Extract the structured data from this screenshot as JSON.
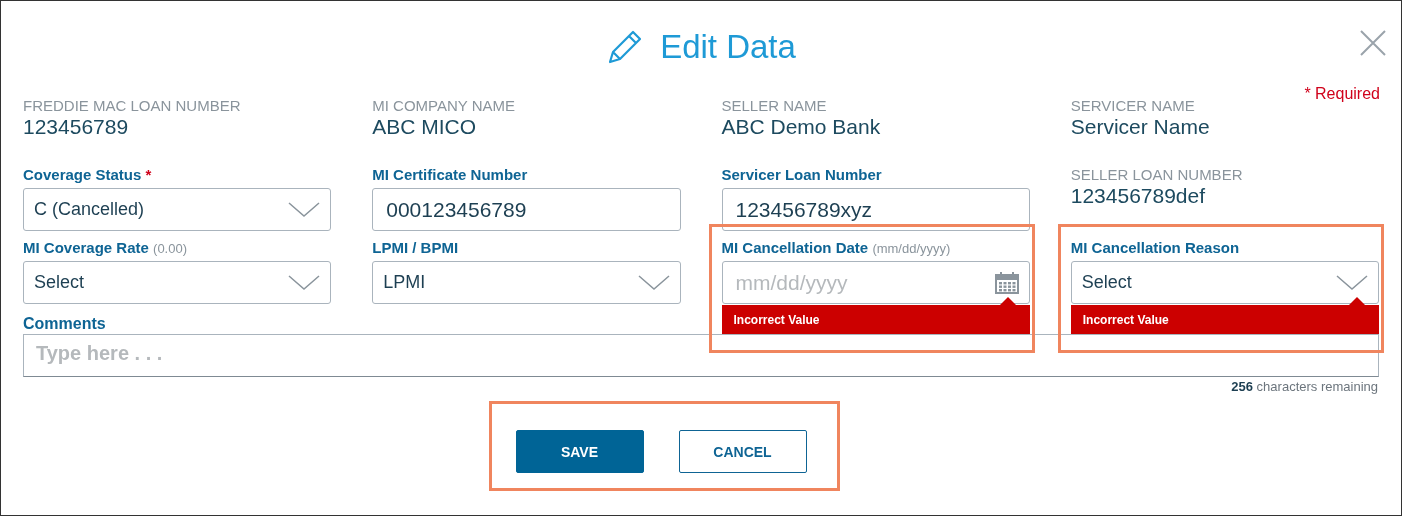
{
  "dialog": {
    "title": "Edit Data",
    "required_note": "* Required",
    "columns": [
      {
        "items": [
          {
            "kind": "info",
            "label": "FREDDIE MAC LOAN NUMBER",
            "value": "123456789"
          },
          {
            "kind": "select",
            "label": "Coverage Status",
            "required_mark": "*",
            "value": "C (Cancelled)"
          },
          {
            "kind": "select",
            "label": "MI Coverage Rate",
            "hint": "(0.00)",
            "value": "Select"
          }
        ]
      },
      {
        "items": [
          {
            "kind": "info",
            "label": "MI COMPANY NAME",
            "value": "ABC MICO"
          },
          {
            "kind": "text",
            "label": "MI Certificate Number",
            "value": "000123456789"
          },
          {
            "kind": "select",
            "label": "LPMI / BPMI",
            "value": "LPMI"
          }
        ]
      },
      {
        "items": [
          {
            "kind": "info",
            "label": "SELLER NAME",
            "value": "ABC Demo Bank"
          },
          {
            "kind": "text",
            "label": "Servicer Loan Number",
            "value": "123456789xyz"
          },
          {
            "kind": "date",
            "label": "MI Cancellation Date",
            "hint": "(mm/dd/yyyy)",
            "placeholder": "mm/dd/yyyy",
            "error": "Incorrect Value",
            "highlighted": true
          }
        ]
      },
      {
        "items": [
          {
            "kind": "info",
            "label": "SERVICER NAME",
            "value": "Servicer Name"
          },
          {
            "kind": "info",
            "label": "SELLER LOAN NUMBER",
            "value": "123456789def"
          },
          {
            "kind": "select",
            "label": "MI Cancellation Reason",
            "value": "Select",
            "error": "Incorrect Value",
            "highlighted": true
          }
        ]
      }
    ],
    "comments": {
      "label": "Comments",
      "placeholder": "Type here . . .",
      "count": "256",
      "count_suffix": "characters remaining"
    },
    "buttons": {
      "highlighted": true,
      "items": [
        {
          "kind": "primary",
          "label": "SAVE"
        },
        {
          "kind": "secondary",
          "label": "CANCEL"
        }
      ]
    }
  }
}
